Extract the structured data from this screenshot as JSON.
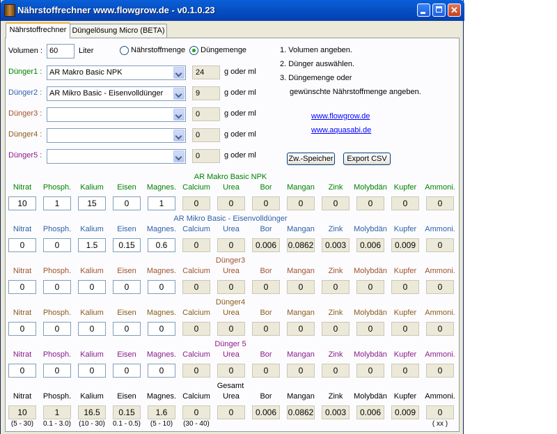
{
  "window": {
    "title": "Nährstoffrechner www.flowgrow.de - v0.1.0.23"
  },
  "tabs": [
    "Nährstoffrechner",
    "Düngelösung Micro (BETA)"
  ],
  "form": {
    "volume_label": "Volumen :",
    "volume_value": "60",
    "volume_unit": "Liter",
    "radio_nutrient": "Nährstoffmenge",
    "radio_fertilizer": "Düngemenge",
    "selected_mode": "Düngemenge",
    "unit_label": "g oder ml"
  },
  "fertilizers": [
    {
      "label": "Dünger1 :",
      "product": "AR Makro Basic NPK",
      "amount": "24",
      "color": "#008000"
    },
    {
      "label": "Dünger2 :",
      "product": "AR Mikro Basic - Eisenvolldünger",
      "amount": "9",
      "color": "#2e5fa8"
    },
    {
      "label": "Dünger3 :",
      "product": "",
      "amount": "0",
      "color": "#a0522d"
    },
    {
      "label": "Dünger4 :",
      "product": "",
      "amount": "0",
      "color": "#8b5a1a"
    },
    {
      "label": "Dünger5 :",
      "product": "",
      "amount": "0",
      "color": "#8b1a8b"
    }
  ],
  "instructions": {
    "step1": "1. Volumen angeben.",
    "step2": "2. Dünger auswählen.",
    "step3": "3. Düngemenge oder",
    "step3b": "gewünschte Nährstoffmenge angeben.",
    "link1": "www.flowgrow.de",
    "link2": "www.aquasabi.de"
  },
  "buttons": {
    "store": "Zw.-Speicher",
    "export": "Export CSV"
  },
  "nutrient_headers": [
    "Nitrat",
    "Phosph.",
    "Kalium",
    "Eisen",
    "Magnes.",
    "Calcium",
    "Urea",
    "Bor",
    "Mangan",
    "Zink",
    "Molybdän",
    "Kupfer",
    "Ammoni."
  ],
  "sections": [
    {
      "title": "AR Makro Basic NPK",
      "color": "#008000",
      "values": [
        "10",
        "1",
        "15",
        "0",
        "1",
        "0",
        "0",
        "0",
        "0",
        "0",
        "0",
        "0",
        "0"
      ]
    },
    {
      "title": "AR Mikro Basic - Eisenvolldünger",
      "color": "#2e5fa8",
      "values": [
        "0",
        "0",
        "1.5",
        "0.15",
        "0.6",
        "0",
        "0",
        "0.006",
        "0.0862",
        "0.003",
        "0.006",
        "0.009",
        "0"
      ]
    },
    {
      "title": "Dünger3",
      "color": "#a0522d",
      "values": [
        "0",
        "0",
        "0",
        "0",
        "0",
        "0",
        "0",
        "0",
        "0",
        "0",
        "0",
        "0",
        "0"
      ]
    },
    {
      "title": "Dünger4",
      "color": "#8b5a1a",
      "values": [
        "0",
        "0",
        "0",
        "0",
        "0",
        "0",
        "0",
        "0",
        "0",
        "0",
        "0",
        "0",
        "0"
      ]
    },
    {
      "title": "Dünger 5",
      "color": "#8b1a8b",
      "values": [
        "0",
        "0",
        "0",
        "0",
        "0",
        "0",
        "0",
        "0",
        "0",
        "0",
        "0",
        "0",
        "0"
      ]
    }
  ],
  "total": {
    "title": "Gesamt",
    "values": [
      "10",
      "1",
      "16.5",
      "0.15",
      "1.6",
      "0",
      "0",
      "0.006",
      "0.0862",
      "0.003",
      "0.006",
      "0.009",
      "0"
    ],
    "ranges": [
      "(5 - 30)",
      "0.1 - 3.0)",
      "(10 - 30)",
      "0.1 - 0.5)",
      "(5 - 10)",
      "(30 - 40)",
      "",
      "",
      "",
      "",
      "",
      "",
      "( xx )"
    ]
  }
}
